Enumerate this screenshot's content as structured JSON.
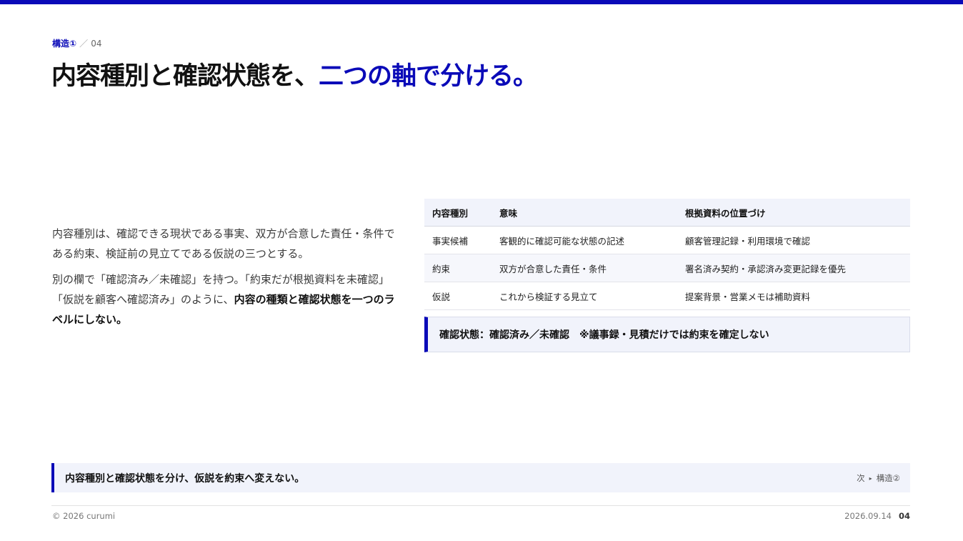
{
  "eyebrow": {
    "section": "構造①",
    "separator": "／",
    "number": "04"
  },
  "title": {
    "part1": "内容種別と確認状態を、",
    "accent": "二つの軸で分ける。"
  },
  "body": {
    "para1": "内容種別は、確認できる現状である事実、双方が合意した責任・条件である約束、検証前の見立てである仮説の三つとする。",
    "para2_plain": "別の欄で「確認済み／未確認」を持つ。「約束だが根拠資料を未確認」「仮説を顧客へ確認済み」のように、",
    "para2_bold": "内容の種類と確認状態を一つのラベルにしない。"
  },
  "table": {
    "headers": [
      "内容種別",
      "意味",
      "根拠資料の位置づけ"
    ],
    "rows": [
      [
        "事実候補",
        "客観的に確認可能な状態の記述",
        "顧客管理記録・利用環境で確認"
      ],
      [
        "約束",
        "双方が合意した責任・条件",
        "署名済み契約・承認済み変更記録を優先"
      ],
      [
        "仮説",
        "これから検証する見立て",
        "提案背景・営業メモは補助資料"
      ]
    ]
  },
  "note": "確認状態：確認済み／未確認　※議事録・見積だけでは約束を確定しない",
  "summary": {
    "message": "内容種別と確認状態を分け、仮説を約束へ変えない。",
    "next_label": "次",
    "next_arrow": "▸",
    "next_target": "構造②"
  },
  "footer": {
    "copyright": "© 2026 curumi",
    "date": "2026.09.14",
    "page": "04"
  },
  "colors": {
    "accent": "#0a0ab8",
    "panel": "#f1f3fb"
  }
}
